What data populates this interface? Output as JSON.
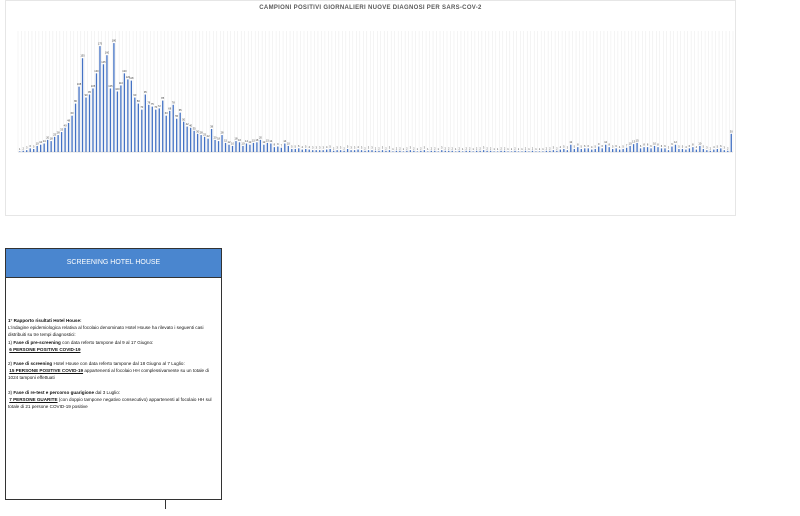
{
  "chart_data": {
    "type": "bar",
    "title": "CAMPIONI POSITIVI GIORNALIERI NUOVE DIAGNOSI PER SARS-COV-2",
    "xlabel": "",
    "ylabel": "",
    "ylim": [
      0,
      200
    ],
    "grid": true,
    "legend": "none",
    "bar_color": "#4472c4",
    "values": [
      1,
      2,
      3,
      6,
      5,
      10,
      12,
      14,
      20,
      18,
      25,
      28,
      33,
      40,
      48,
      60,
      80,
      108,
      155,
      90,
      95,
      105,
      130,
      175,
      145,
      160,
      105,
      180,
      100,
      110,
      130,
      120,
      118,
      90,
      80,
      70,
      95,
      78,
      75,
      70,
      72,
      85,
      60,
      68,
      78,
      55,
      65,
      50,
      42,
      40,
      35,
      30,
      28,
      25,
      22,
      38,
      20,
      18,
      28,
      15,
      12,
      10,
      18,
      16,
      10,
      14,
      12,
      15,
      16,
      20,
      12,
      15,
      14,
      8,
      9,
      7,
      14,
      10,
      5,
      5,
      6,
      4,
      5,
      4,
      3,
      3,
      3,
      3,
      4,
      5,
      2,
      3,
      3,
      2,
      5,
      3,
      3,
      4,
      3,
      2,
      3,
      3,
      2,
      2,
      3,
      2,
      3,
      1,
      2,
      2,
      1,
      2,
      3,
      2,
      1,
      2,
      3,
      1,
      2,
      2,
      1,
      3,
      2,
      2,
      2,
      1,
      2,
      1,
      2,
      2,
      1,
      2,
      2,
      3,
      2,
      2,
      1,
      1,
      2,
      2,
      1,
      1,
      2,
      1,
      1,
      2,
      1,
      2,
      1,
      1,
      1,
      2,
      2,
      3,
      2,
      4,
      5,
      3,
      12,
      5,
      8,
      5,
      6,
      6,
      4,
      5,
      9,
      6,
      12,
      8,
      5,
      6,
      4,
      5,
      7,
      10,
      13,
      15,
      6,
      8,
      8,
      6,
      10,
      8,
      6,
      6,
      3,
      9,
      12,
      5,
      5,
      4,
      6,
      8,
      4,
      10,
      5,
      3,
      2,
      4,
      5,
      6,
      3,
      2,
      30
    ]
  },
  "screening": {
    "header": "SCREENING HOTEL HOUSE",
    "heading": "1° Rapporto  risultati Hotel House:",
    "intro_1": "L'indagine epidemiologica relativa al focolaio denominato Hotel House ha rilevato i seguenti casi",
    "intro_2": "distribuiti su tre tempi diagnostici:",
    "p1_num": "1) ",
    "p1_bold": "Fase di pre-screening",
    "p1_rest": " con data referto tampone dal 9 al 17 Giugno:",
    "p1_result": "6 PERSONE POSITIVE COVID-19",
    "p2_num": "2) ",
    "p2_bold": "Fase di screening",
    "p2_rest": " Hotel House con data referto tampone dal 18 Giugno al 7 Luglio:",
    "p2_result": "15 PERSONE POSITIVE COVID-19",
    "p2_result_rest": " appartenenti al focolaio HH complessivamente su un totale di",
    "p2_line3": "1024 tamponi effettuati",
    "p3_num": "3) ",
    "p3_bold": "Fase di re-test e percorso guarigione",
    "p3_rest": " dal 3 Luglio:",
    "p3_result": "7 PERSONE GUARITE",
    "p3_result_rest": " (con doppio tampone negativo consecutivo) appartenenti al focolaio HH sul",
    "p3_line3": "totale di 21 persone COVID-19 positive"
  }
}
